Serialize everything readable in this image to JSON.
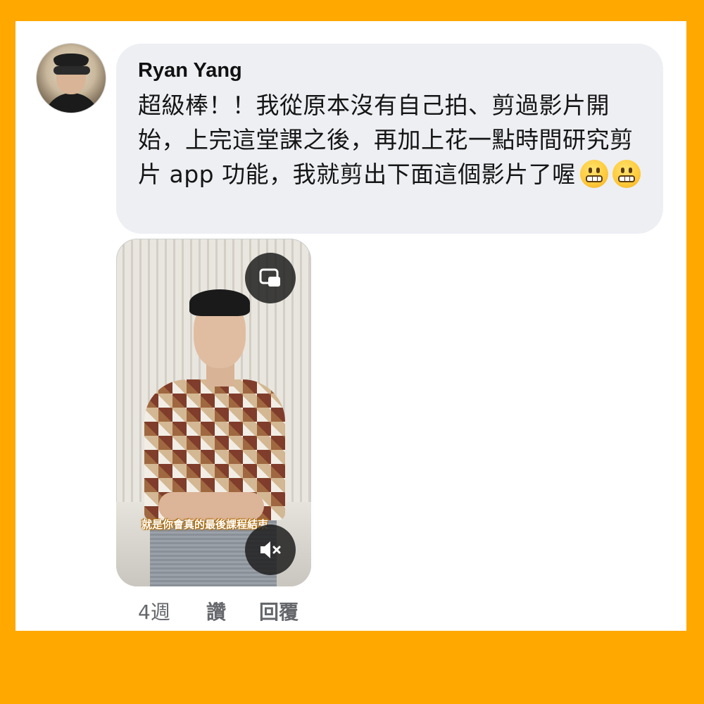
{
  "comment": {
    "author": "Ryan Yang",
    "text": "超級棒！！我從原本沒有自己拍、剪過影片開始，上完這堂課之後，再加上花一點時間研究剪片 app 功能，我就剪出下面這個影片了喔",
    "emojis": [
      "grimacing-face-emoji",
      "grimacing-face-emoji"
    ]
  },
  "video": {
    "subtitle": "就是你會真的最後課程結束",
    "buttons": [
      "picture-in-picture-icon",
      "mute-icon"
    ]
  },
  "actions": {
    "time": "4週",
    "like": "讚",
    "reply": "回覆"
  },
  "colors": {
    "frame": "#FFA800",
    "bubble": "#EDEFF3",
    "meta_text": "#65676B"
  }
}
